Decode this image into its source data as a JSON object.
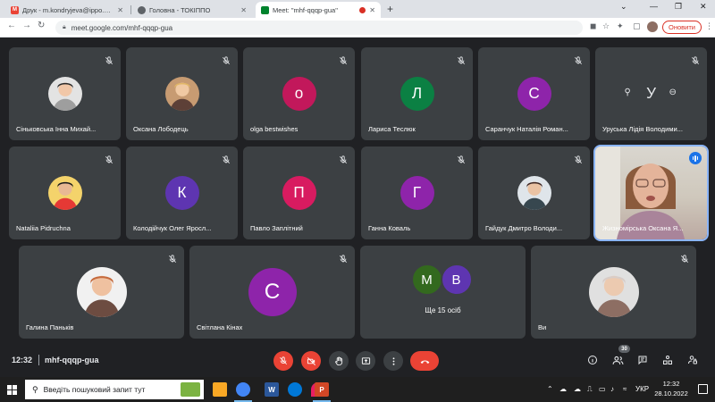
{
  "browser": {
    "tabs": [
      {
        "title": "Друк - m.kondryjeva@ippo.edu",
        "favicon": "gmail-icon",
        "active": false
      },
      {
        "title": "Головна - ТОКІППО",
        "favicon": "globe-icon",
        "active": false
      },
      {
        "title": "Meet: \"mhf-qqqp-gua\"",
        "favicon": "meet-icon",
        "active": true,
        "recording": true
      }
    ],
    "new_tab_label": "+",
    "url": "meet.google.com/mhf-qqqp-gua",
    "update_button_label": "Оновити"
  },
  "participants": [
    {
      "name": "Сіньковська Інна Михай...",
      "avatar_type": "photo",
      "photo_bg": "#e3e3e3",
      "muted": true
    },
    {
      "name": "Оксана Лободець",
      "avatar_type": "photo",
      "photo_bg": "#c79b72",
      "muted": true
    },
    {
      "name": "olga bestwishes",
      "avatar_type": "letter",
      "letter": "o",
      "color": "#c2185b",
      "muted": true
    },
    {
      "name": "Лариса Теслюк",
      "avatar_type": "letter",
      "letter": "Л",
      "color": "#0b8043",
      "muted": true
    },
    {
      "name": "Саранчук Наталія Роман...",
      "avatar_type": "letter",
      "letter": "С",
      "color": "#8e24aa",
      "muted": true
    },
    {
      "name": "Уруська Лідія Володими...",
      "avatar_type": "letter-hover",
      "letter": "У",
      "color": "#5f6368",
      "muted": true
    },
    {
      "name": "Nataliia Pidruchna",
      "avatar_type": "photo",
      "photo_bg": "#f4d36b",
      "muted": true
    },
    {
      "name": "Колодійчук Олег Яросл...",
      "avatar_type": "letter",
      "letter": "К",
      "color": "#5e35b1",
      "muted": true
    },
    {
      "name": "Павло Заплітний",
      "avatar_type": "letter",
      "letter": "П",
      "color": "#d81b60",
      "muted": true
    },
    {
      "name": "Ганна Коваль",
      "avatar_type": "letter",
      "letter": "Г",
      "color": "#8e24aa",
      "muted": true
    },
    {
      "name": "Гайдук Дмитро Володи...",
      "avatar_type": "photo",
      "photo_bg": "#dfe5ea",
      "muted": true
    },
    {
      "name": "Жизномірська Оксана Я...",
      "avatar_type": "video",
      "muted": false,
      "speaking": true
    },
    {
      "name": "Галина Паньків",
      "avatar_type": "photo",
      "photo_bg": "#f1f1f1",
      "muted": true
    },
    {
      "name": "Світлана Кінах",
      "avatar_type": "letter",
      "letter": "С",
      "color": "#8e24aa",
      "muted": true
    },
    {
      "name": "Ще 15 осіб",
      "avatar_type": "group",
      "letters": [
        "М",
        "В"
      ],
      "colors": [
        "#33691e",
        "#5e35b1"
      ],
      "muted": false
    },
    {
      "name": "Ви",
      "avatar_type": "photo",
      "photo_bg": "#e0e0e0",
      "muted": true
    }
  ],
  "bottom_bar": {
    "time": "12:32",
    "meeting_code": "mhf-qqqp-gua",
    "participants_count": "30",
    "controls": [
      "mic-off",
      "camera-off",
      "raise-hand",
      "present",
      "more",
      "end-call"
    ],
    "right_icons": [
      "info",
      "people",
      "chat",
      "activities",
      "host-controls"
    ]
  },
  "taskbar": {
    "search_placeholder": "Введіть пошуковий запит тут",
    "language": "УКР",
    "clock_time": "12:32",
    "clock_date": "28.10.2022"
  },
  "colors": {
    "meet_bg": "#202124",
    "tile_bg": "#3c4043",
    "end_call": "#ea4335",
    "active_outline": "#8ab4f8"
  }
}
